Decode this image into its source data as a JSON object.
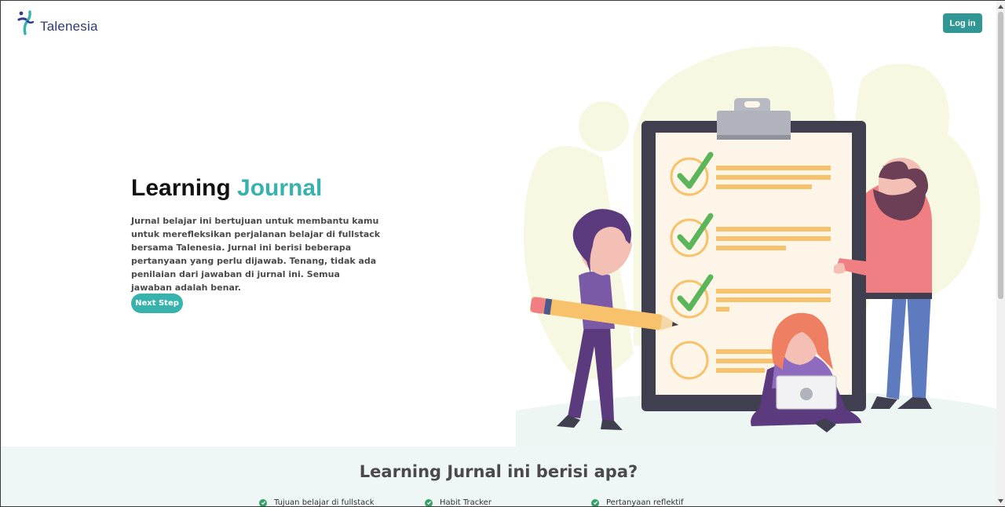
{
  "header": {
    "logo_text": "Talenesia",
    "login_label": "Log in"
  },
  "hero": {
    "title_part1": "Learning ",
    "title_part2": "Journal",
    "description": "Jurnal belajar ini bertujuan untuk membantu kamu untuk merefleksikan perjalanan belajar di fullstack bersama Talenesia. Jurnal ini berisi beberapa pertanyaan yang perlu dijawab. Tenang, tidak ada penilaian dari jawaban di jurnal ini. Semua jawaban adalah benar.",
    "next_label": "Next Step"
  },
  "section": {
    "title": "Learning Jurnal ini berisi apa?",
    "features": [
      {
        "label": "Tujuan belajar di fullstack"
      },
      {
        "label": "Habit Tracker"
      },
      {
        "label": "Pertanyaan reflektif"
      }
    ]
  },
  "colors": {
    "accent": "#38b2ac",
    "button": "#319795",
    "check": "#38a169",
    "section_bg": "#eef7f5"
  }
}
